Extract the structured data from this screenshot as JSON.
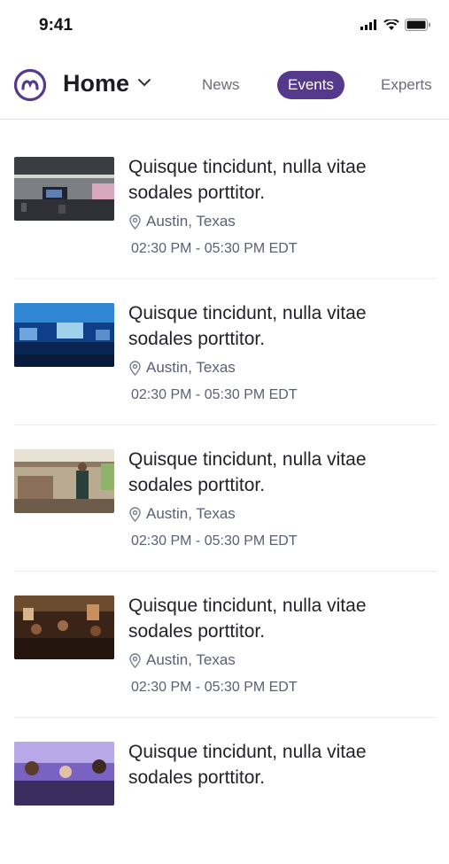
{
  "status_bar": {
    "time": "9:41"
  },
  "header": {
    "title": "Home",
    "tabs": [
      {
        "label": "News",
        "active": false
      },
      {
        "label": "Events",
        "active": true
      },
      {
        "label": "Experts",
        "active": false
      }
    ],
    "accent_color": "#553a8b"
  },
  "events": [
    {
      "title": "Quisque tincidunt, nulla vitae sodales porttitor.",
      "location": "Austin, Texas",
      "time": "02:30 PM - 05:30 PM EDT"
    },
    {
      "title": "Quisque tincidunt, nulla vitae sodales porttitor.",
      "location": "Austin, Texas",
      "time": "02:30 PM - 05:30 PM EDT"
    },
    {
      "title": "Quisque tincidunt, nulla vitae sodales porttitor.",
      "location": "Austin, Texas",
      "time": "02:30 PM - 05:30 PM EDT"
    },
    {
      "title": "Quisque tincidunt, nulla vitae sodales porttitor.",
      "location": "Austin, Texas",
      "time": "02:30 PM - 05:30 PM EDT"
    },
    {
      "title": "Quisque tincidunt, nulla vitae sodales porttitor.",
      "location": "",
      "time": ""
    }
  ]
}
